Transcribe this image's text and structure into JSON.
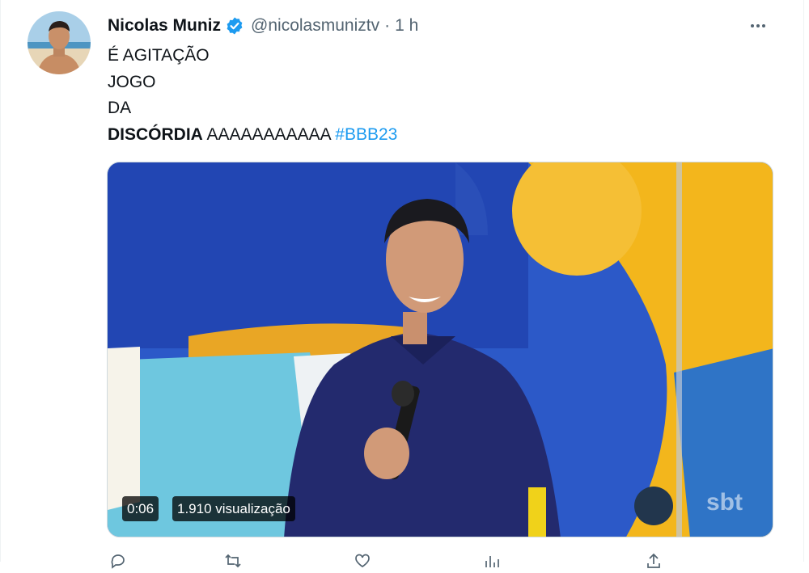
{
  "tweet": {
    "author": {
      "display_name": "Nicolas Muniz",
      "handle": "@nicolasmuniztv",
      "verified": true
    },
    "separator": "·",
    "timestamp": "1 h",
    "text_lines": [
      "É AGITAÇÃO",
      "JOGO",
      "DA"
    ],
    "last_line": {
      "bold": "DISCÓRDIA",
      "plain": " AAAAAAAAAAA ",
      "hashtag": "#BBB23"
    }
  },
  "video": {
    "duration": "0:06",
    "views": "1.910 visualização",
    "watermark": "sbt"
  },
  "icons": {
    "more": "more-horizontal-icon",
    "verified": "verified-badge-icon",
    "reply": "reply-icon",
    "retweet": "retweet-icon",
    "like": "like-icon",
    "views": "views-icon",
    "share": "share-icon"
  },
  "colors": {
    "accent": "#1d9bf0",
    "text_primary": "#0f1419",
    "text_secondary": "#536471"
  }
}
